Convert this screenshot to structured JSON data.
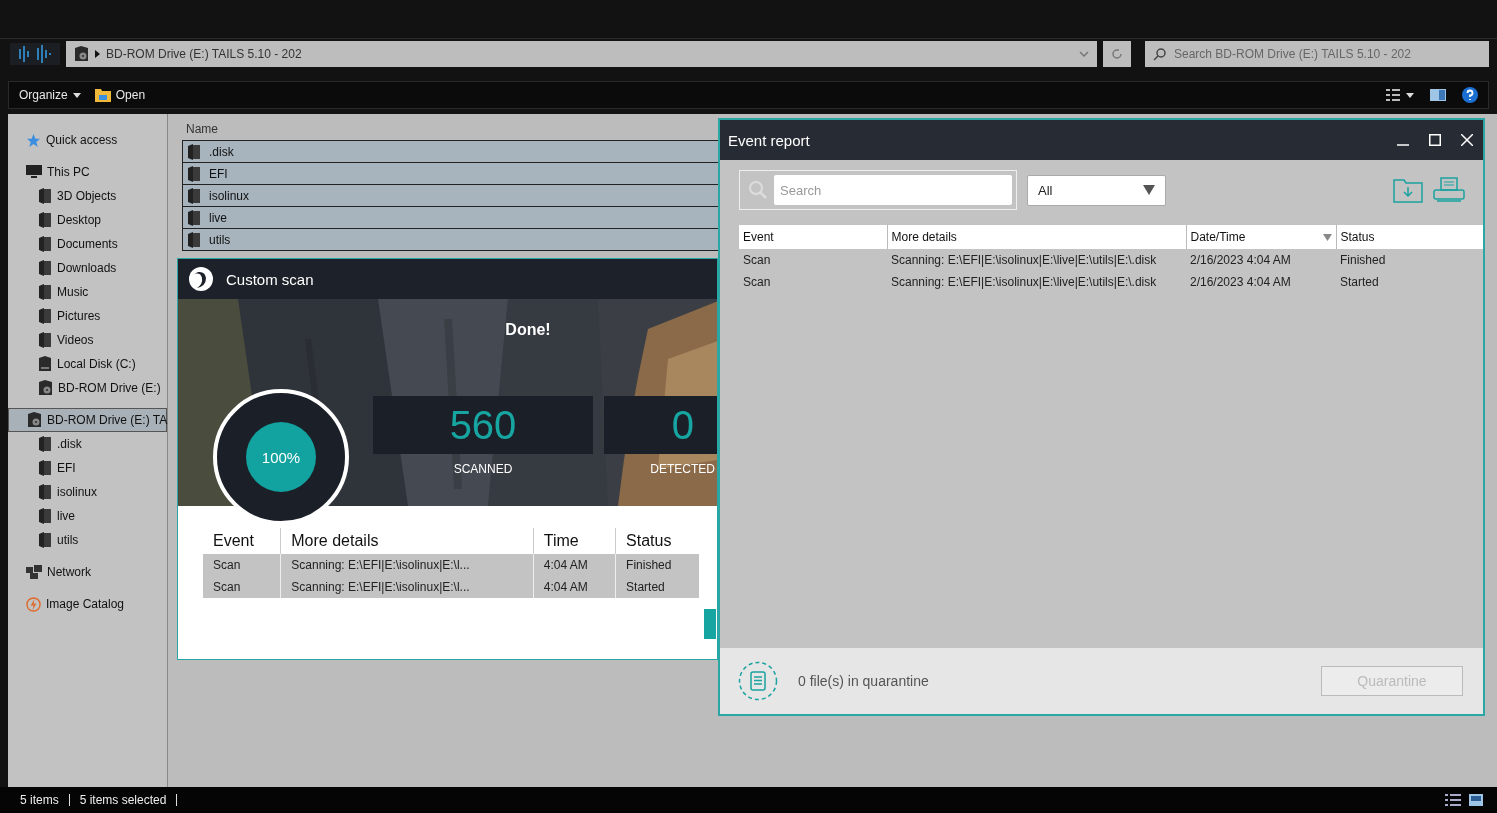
{
  "explorer": {
    "address": "BD-ROM Drive (E:) TAILS 5.10 - 202",
    "search_placeholder": "Search BD-ROM Drive (E:) TAILS 5.10 - 202",
    "toolbar": [
      {
        "label": "Organize",
        "kind": "menu"
      },
      {
        "label": "Open",
        "kind": "open"
      }
    ],
    "sidebar": [
      {
        "label": "Quick access",
        "kind": "star",
        "selected": false
      },
      {
        "label": "This PC",
        "kind": "pc",
        "selected": false,
        "children": [
          {
            "label": "3D Objects",
            "kind": "folder",
            "selected": false
          },
          {
            "label": "Desktop",
            "kind": "folder",
            "selected": false
          },
          {
            "label": "Documents",
            "kind": "folder",
            "selected": false
          },
          {
            "label": "Downloads",
            "kind": "folder",
            "selected": false
          },
          {
            "label": "Music",
            "kind": "folder",
            "selected": false
          },
          {
            "label": "Pictures",
            "kind": "folder",
            "selected": false
          },
          {
            "label": "Videos",
            "kind": "folder",
            "selected": false
          },
          {
            "label": "Local Disk (C:)",
            "kind": "drive",
            "selected": false
          },
          {
            "label": "BD-ROM Drive (E:)",
            "kind": "disc",
            "selected": false
          }
        ]
      },
      {
        "label": "BD-ROM Drive (E:) TA",
        "kind": "disc",
        "selected": true,
        "children": [
          {
            "label": ".disk",
            "kind": "folder",
            "selected": false
          },
          {
            "label": "EFI",
            "kind": "folder",
            "selected": false
          },
          {
            "label": "isolinux",
            "kind": "folder",
            "selected": false
          },
          {
            "label": "live",
            "kind": "folder",
            "selected": false
          },
          {
            "label": "utils",
            "kind": "folder",
            "selected": false
          }
        ]
      },
      {
        "label": "Network",
        "kind": "network",
        "selected": false
      },
      {
        "label": "Image Catalog",
        "kind": "catalog",
        "selected": false
      }
    ],
    "columns": [
      "Name"
    ],
    "files": [
      {
        "name": ".disk",
        "selected": true
      },
      {
        "name": "EFI",
        "selected": true
      },
      {
        "name": "isolinux",
        "selected": true
      },
      {
        "name": "live",
        "selected": true
      },
      {
        "name": "utils",
        "selected": true
      }
    ],
    "status": [
      "5 items",
      "5 items selected"
    ]
  },
  "scan": {
    "title": "Custom scan",
    "headline": "Done!",
    "progress": "100%",
    "stats": [
      {
        "value": "560",
        "label": "SCANNED"
      },
      {
        "value": "0",
        "label": "DETECTED"
      }
    ],
    "columns": [
      "Event",
      "More details",
      "Time",
      "Status"
    ],
    "rows": [
      [
        "Scan",
        "Scanning: E:\\EFI|E:\\isolinux|E:\\l...",
        "4:04 AM",
        "Finished"
      ],
      [
        "Scan",
        "Scanning: E:\\EFI|E:\\isolinux|E:\\l...",
        "4:04 AM",
        "Started"
      ]
    ]
  },
  "event_report": {
    "title": "Event report",
    "search_placeholder": "Search",
    "filter": "All",
    "columns": [
      {
        "label": "Event",
        "sorted": false
      },
      {
        "label": "More details",
        "sorted": false
      },
      {
        "label": "Date/Time",
        "sorted": true
      },
      {
        "label": "Status",
        "sorted": false
      }
    ],
    "rows": [
      [
        "Scan",
        "Scanning: E:\\EFI|E:\\isolinux|E:\\live|E:\\utils|E:\\.disk",
        "2/16/2023 4:04 AM",
        "Finished"
      ],
      [
        "Scan",
        "Scanning: E:\\EFI|E:\\isolinux|E:\\live|E:\\utils|E:\\.disk",
        "2/16/2023 4:04 AM",
        "Started"
      ]
    ],
    "quarantine_count": "0 file(s) in quarantine",
    "quarantine_button": {
      "label": "Quarantine",
      "disabled": true
    }
  }
}
